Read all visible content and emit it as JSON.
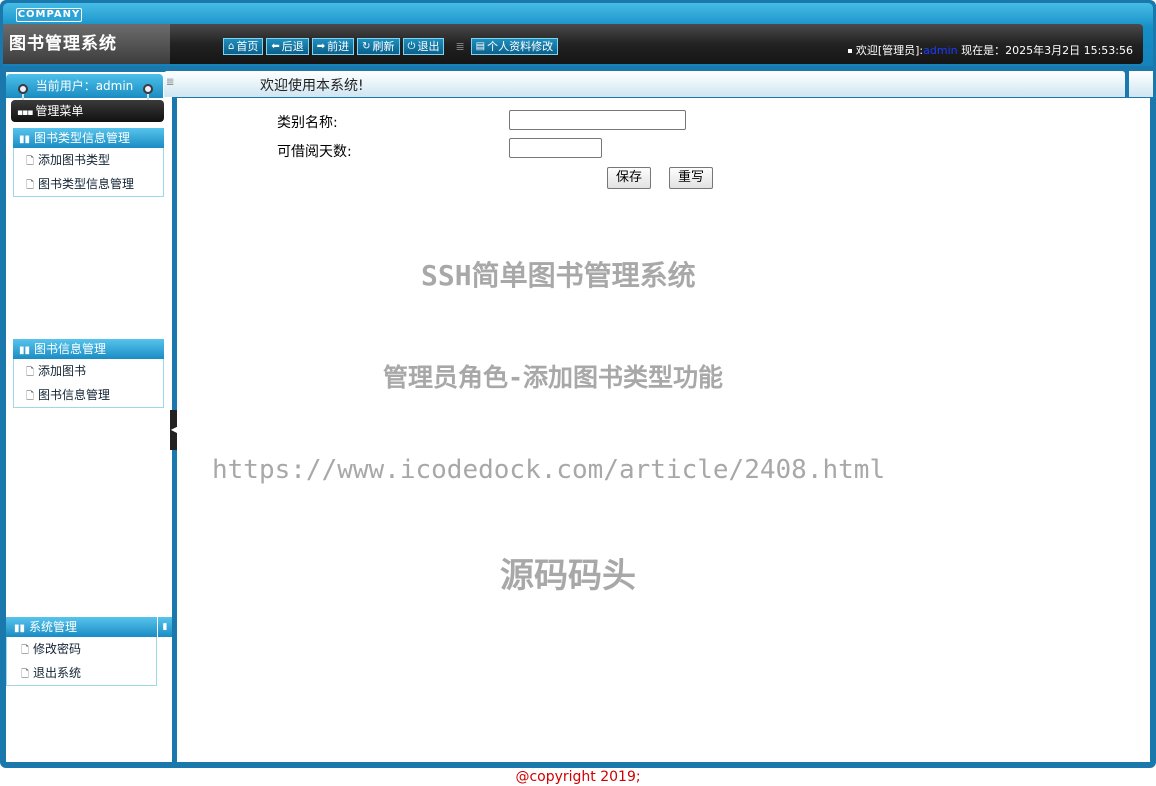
{
  "header": {
    "company": "COMPANY",
    "app_title": "图书管理系统",
    "toolbar": [
      {
        "icon": "home-icon",
        "glyph": "⌂",
        "label": "首页"
      },
      {
        "icon": "arrow-left-icon",
        "glyph": "⬅",
        "label": "后退"
      },
      {
        "icon": "arrow-right-icon",
        "glyph": "➡",
        "label": "前进"
      },
      {
        "icon": "refresh-icon",
        "glyph": "↻",
        "label": "刷新"
      },
      {
        "icon": "power-icon",
        "glyph": "⏻",
        "label": "退出"
      },
      {
        "icon": "profile-icon",
        "glyph": "▤",
        "label": "个人资料修改"
      }
    ],
    "status": {
      "welcome_prefix": "欢迎[管理员]:",
      "username": "admin",
      "time_label": " 现在是：2025年3月2日 15:53:56"
    }
  },
  "sidebar": {
    "current_user": "当前用户：admin",
    "menu_title": "管理菜单",
    "groups": [
      {
        "title": "图书类型信息管理",
        "items": [
          "添加图书类型",
          "图书类型信息管理"
        ]
      },
      {
        "title": "图书信息管理",
        "items": [
          "添加图书",
          "图书信息管理"
        ]
      },
      {
        "title": "系统管理",
        "items": [
          "修改密码",
          "退出系统"
        ]
      }
    ]
  },
  "main": {
    "welcome": "欢迎使用本系统!",
    "form": {
      "category_label": "类别名称:",
      "category_value": "",
      "days_label": "可借阅天数:",
      "days_value": "",
      "save_label": "保存",
      "reset_label": "重写"
    },
    "watermarks": [
      "SSH简单图书管理系统",
      "管理员角色-添加图书类型功能",
      "https://www.icodedock.com/article/2408.html",
      "源码码头"
    ]
  },
  "footer": {
    "copyright": "@copyright 2019;"
  },
  "colors": {
    "frame": "#1b78ad",
    "accent": "#1a8cc2",
    "watermark": "#a8a8a8",
    "footer_text": "#d00000",
    "username": "#1a3cff"
  }
}
